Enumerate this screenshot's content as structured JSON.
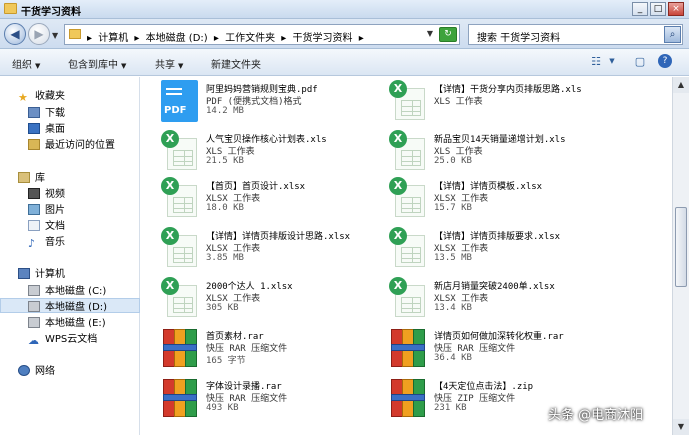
{
  "window": {
    "title": "干货学习资料",
    "controls": [
      "_",
      "□",
      "×"
    ]
  },
  "address": {
    "crumbs": [
      "计算机",
      "本地磁盘 (D:)",
      "工作文件夹",
      "干货学习资料"
    ],
    "search_placeholder": "搜索 干货学习资料"
  },
  "toolbar": {
    "organize": "组织",
    "include": "包含到库中",
    "share": "共享",
    "new_folder": "新建文件夹"
  },
  "sidebar": {
    "favorites": "收藏夹",
    "favorites_items": [
      "下载",
      "桌面",
      "最近访问的位置"
    ],
    "libraries": "库",
    "libraries_items": [
      "视频",
      "图片",
      "文档",
      "音乐"
    ],
    "computer": "计算机",
    "computer_items": [
      "本地磁盘 (C:)",
      "本地磁盘 (D:)",
      "本地磁盘 (E:)",
      "WPS云文档"
    ],
    "network": "网络"
  },
  "files": [
    {
      "name": "阿里妈妈营销规则宝典.pdf",
      "type": "PDF (便携式文档)格式",
      "size": "14.2 MB",
      "kind": "pdf"
    },
    {
      "name": "【详情】干货分享内页排版思路.xls",
      "type": "XLS 工作表",
      "size": "",
      "kind": "xls"
    },
    {
      "name": "人气宝贝操作核心计划表.xls",
      "type": "XLS 工作表",
      "size": "21.5 KB",
      "kind": "xls"
    },
    {
      "name": "新品宝贝14天销量递增计划.xls",
      "type": "XLS 工作表",
      "size": "25.0 KB",
      "kind": "xls"
    },
    {
      "name": "【首页】首页设计.xlsx",
      "type": "XLSX 工作表",
      "size": "18.0 KB",
      "kind": "xls"
    },
    {
      "name": "【详情】详情页模板.xlsx",
      "type": "XLSX 工作表",
      "size": "15.7 KB",
      "kind": "xls"
    },
    {
      "name": "【详情】详情页排版设计思路.xlsx",
      "type": "XLSX 工作表",
      "size": "3.85 MB",
      "kind": "xls"
    },
    {
      "name": "【详情】详情页排版要求.xlsx",
      "type": "XLSX 工作表",
      "size": "13.5 MB",
      "kind": "xls"
    },
    {
      "name": "2000个达人 1.xlsx",
      "type": "XLSX 工作表",
      "size": "305 KB",
      "kind": "xls"
    },
    {
      "name": "新店月销量突破2400单.xlsx",
      "type": "XLSX 工作表",
      "size": "13.4 KB",
      "kind": "xls"
    },
    {
      "name": "首页素材.rar",
      "type": "快压 RAR 压缩文件",
      "size": "165 字节",
      "kind": "rar"
    },
    {
      "name": "详情页如何做加深转化权重.rar",
      "type": "快压 RAR 压缩文件",
      "size": "36.4 KB",
      "kind": "rar"
    },
    {
      "name": "字体设计录播.rar",
      "type": "快压 RAR 压缩文件",
      "size": "493 KB",
      "kind": "rar"
    },
    {
      "name": "【4天定位点击法】.zip",
      "type": "快压 ZIP 压缩文件",
      "size": "231 KB",
      "kind": "rar"
    }
  ],
  "watermark": "头条 @电商沐阳"
}
